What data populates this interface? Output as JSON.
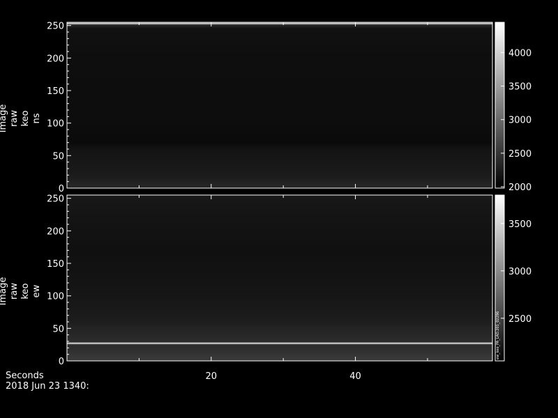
{
  "chart_data": [
    {
      "type": "heatmap",
      "ylabel_lines": [
        "Image",
        "raw",
        "keo",
        "ns"
      ],
      "y_ticks": [
        0,
        50,
        100,
        150,
        200,
        250
      ],
      "ylim": [
        0,
        255
      ],
      "x_ticks": [
        20,
        40
      ],
      "xlim": [
        0,
        59
      ],
      "colorbar": {
        "ticks": [
          2000,
          2500,
          3000,
          3500,
          4000
        ],
        "range": [
          1980,
          4450
        ]
      },
      "profile": [
        {
          "y": 0,
          "value": 2320
        },
        {
          "y": 5,
          "value": 2350
        },
        {
          "y": 10,
          "value": 2300
        },
        {
          "y": 15,
          "value": 2260
        },
        {
          "y": 20,
          "value": 2240
        },
        {
          "y": 30,
          "value": 2220
        },
        {
          "y": 40,
          "value": 2200
        },
        {
          "y": 50,
          "value": 2190
        },
        {
          "y": 60,
          "value": 2160
        },
        {
          "y": 70,
          "value": 2080
        },
        {
          "y": 80,
          "value": 2090
        },
        {
          "y": 100,
          "value": 2110
        },
        {
          "y": 150,
          "value": 2110
        },
        {
          "y": 200,
          "value": 2115
        },
        {
          "y": 245,
          "value": 2140
        },
        {
          "y": 251,
          "value": 2350
        },
        {
          "y": 253,
          "value": 4200
        },
        {
          "y": 255,
          "value": 2600
        }
      ]
    },
    {
      "type": "heatmap",
      "ylabel_lines": [
        "Image",
        "raw",
        "keo",
        "ew"
      ],
      "y_ticks": [
        0,
        50,
        100,
        150,
        200,
        250
      ],
      "ylim": [
        0,
        255
      ],
      "x_ticks": [
        20,
        40
      ],
      "xlim": [
        0,
        59
      ],
      "colorbar": {
        "ticks": [
          2500,
          3000,
          3500
        ],
        "range": [
          2050,
          3800
        ]
      },
      "profile": [
        {
          "y": 0,
          "value": 2450
        },
        {
          "y": 8,
          "value": 2420
        },
        {
          "y": 15,
          "value": 2380
        },
        {
          "y": 22,
          "value": 2360
        },
        {
          "y": 25,
          "value": 2360
        },
        {
          "y": 27,
          "value": 3700
        },
        {
          "y": 29,
          "value": 2360
        },
        {
          "y": 40,
          "value": 2320
        },
        {
          "y": 50,
          "value": 2300
        },
        {
          "y": 60,
          "value": 2250
        },
        {
          "y": 80,
          "value": 2220
        },
        {
          "y": 100,
          "value": 2200
        },
        {
          "y": 130,
          "value": 2180
        },
        {
          "y": 170,
          "value": 2160
        },
        {
          "y": 210,
          "value": 2180
        },
        {
          "y": 240,
          "value": 2200
        },
        {
          "y": 255,
          "value": 2220
        }
      ],
      "side_annotation": "ew_keo_PA_LAO.201_02296"
    }
  ],
  "footer": {
    "xlabel": "Seconds",
    "date": "2018 Jun 23 1340:"
  }
}
